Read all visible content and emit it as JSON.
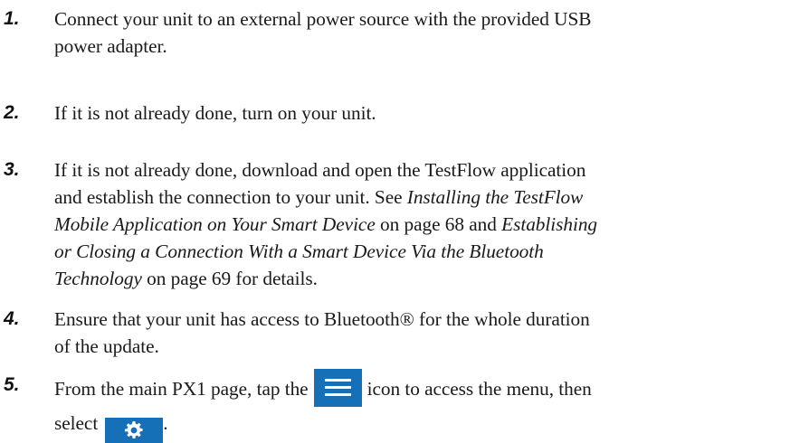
{
  "steps": [
    {
      "number": "1.",
      "lines": [
        "Connect your unit to an external power source with the provided USB",
        "power adapter."
      ]
    },
    {
      "number": "2.",
      "text": "If it is not already done, turn on your unit."
    },
    {
      "number": "3.",
      "l1": "If it is not already done, download and open the TestFlow application",
      "l2": "and establish the connection to your unit. See ",
      "ref1_a": "Installing the TestFlow",
      "ref1_b": "Mobile Application on Your Smart Device",
      "p1": " on page 68 and ",
      "ref2_a": "Establishing",
      "ref2_b": "or Closing a Connection With a Smart Device Via the Bluetooth",
      "ref2_c": "Technology",
      "p2": " on page 69 for details."
    },
    {
      "number": "4.",
      "lines": [
        "Ensure that your unit has access to Bluetooth® for the whole duration",
        "of the update."
      ]
    },
    {
      "number": "5.",
      "before_icon": "From the main PX1 page, tap the",
      "after_icon": "icon to access the menu, then",
      "select_word": "select",
      "period": ".",
      "menu_icon": "hamburger-menu-icon",
      "settings_icon": "gear-icon",
      "icon_color": "#1570b8"
    }
  ]
}
